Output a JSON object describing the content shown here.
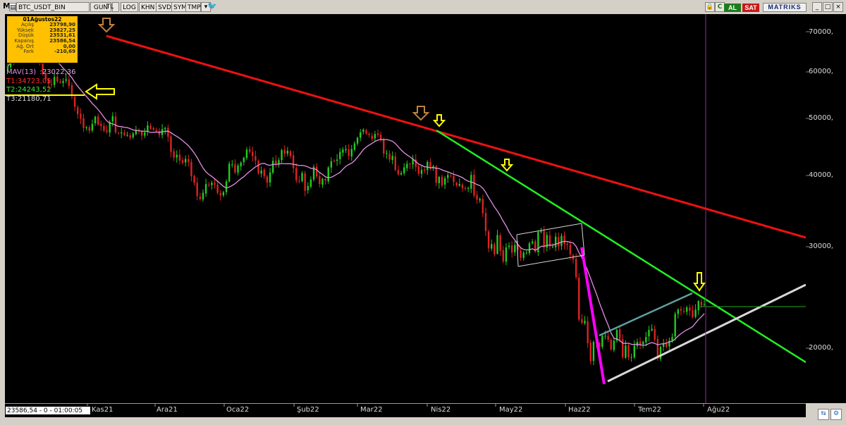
{
  "toolbar": {
    "m_label": "M",
    "symbol": "BTC_USDT_BIN",
    "period": "GUN",
    "currency": "TL",
    "buttons": [
      "LOG",
      "KHN",
      "SVD",
      "SYM",
      "TMP"
    ],
    "al_label": "AL",
    "sat_label": "SAT",
    "brand": "MATRIKS"
  },
  "info_box": {
    "date": "01Ağustos22",
    "rows": [
      {
        "label": "Açılış",
        "value": "23798,90"
      },
      {
        "label": "Yüksek",
        "value": "23827,25"
      },
      {
        "label": "Düşük",
        "value": "23531,61"
      },
      {
        "label": "Kapanış",
        "value": "23586,54"
      },
      {
        "label": "Ağ. Ort",
        "value": "0,00"
      },
      {
        "label": "Fark",
        "value": "-210,69"
      }
    ]
  },
  "indicators": {
    "mav_name": "MAV(13)",
    "mav_value": ":23022,36",
    "t1": "T1:34723,05",
    "t2": "T2:24243,52",
    "t3": "T3:21180,71"
  },
  "status_text": "23586,54 - 0 - 01:00:05",
  "x_axis": [
    "Kas21",
    "Ara21",
    "Oca22",
    "Şub22",
    "Mar22",
    "Nis22",
    "May22",
    "Haz22",
    "Tem22",
    "Ağu22"
  ],
  "y_axis": [
    "70000,",
    "60000,",
    "50000,",
    "40000,",
    "30000,",
    "20000,"
  ],
  "colors": {
    "up": "#22cc22",
    "down": "#dd2222",
    "mav": "#e090e0",
    "trend_red": "#ee1111",
    "trend_green": "#22ee22",
    "arrow_brown": "#c08040",
    "arrow_yellow": "#ffff00"
  },
  "chart_data": {
    "type": "candlestick",
    "symbol": "BTC_USDT_BIN",
    "log_scale": true,
    "ylim": [
      16000,
      75000
    ],
    "x_ticks": [
      "Kas21",
      "Ara21",
      "Oca22",
      "Şub22",
      "Mar22",
      "Nis22",
      "May22",
      "Haz22",
      "Tem22",
      "Ağu22"
    ],
    "y_ticks": [
      70000,
      60000,
      50000,
      40000,
      30000,
      20000
    ],
    "closes": [
      61000,
      63000,
      62500,
      65000,
      64500,
      66000,
      68500,
      67000,
      66500,
      64800,
      65500,
      62000,
      59500,
      58000,
      57000,
      56800,
      58500,
      57500,
      57300,
      57600,
      58000,
      56500,
      54200,
      52000,
      50500,
      49600,
      47800,
      48000,
      47300,
      48600,
      50000,
      48500,
      48200,
      47300,
      47100,
      49000,
      50100,
      47000,
      46800,
      47000,
      46500,
      46500,
      46000,
      46800,
      47500,
      47200,
      46400,
      47000,
      48300,
      47700,
      47500,
      47200,
      46500,
      47600,
      47800,
      46200,
      43500,
      42500,
      43000,
      42000,
      41600,
      42300,
      41800,
      39500,
      38500,
      36500,
      36100,
      37000,
      38300,
      38100,
      38500,
      38200,
      37000,
      36600,
      37100,
      38700,
      41500,
      41400,
      40100,
      41200,
      41700,
      42500,
      43900,
      43500,
      42800,
      42000,
      40000,
      40400,
      39500,
      38500,
      40100,
      42000,
      41500,
      42100,
      43800,
      43200,
      43700,
      42800,
      40800,
      38900,
      38800,
      40000,
      37300,
      38000,
      39000,
      41000,
      39500,
      38300,
      39100,
      38800,
      40900,
      41900,
      41900,
      42200,
      43500,
      43900,
      44000,
      42800,
      44000,
      45000,
      46000,
      47000,
      47500,
      46800,
      46500,
      45800,
      46700,
      46500,
      45600,
      43200,
      43300,
      42200,
      42800,
      40500,
      39800,
      40000,
      40900,
      41500,
      41400,
      42300,
      41000,
      39900,
      40500,
      40400,
      41800,
      40800,
      41100,
      38500,
      39400,
      38100,
      39200,
      39700,
      39500,
      38600,
      38100,
      38300,
      37700,
      37600,
      37700,
      39700,
      36600,
      36000,
      36100,
      34100,
      31800,
      29700,
      30200,
      29000,
      31300,
      29400,
      28200,
      29800,
      30000,
      29200,
      30100,
      29500,
      28600,
      29200,
      29200,
      30300,
      30500,
      29300,
      31700,
      31800,
      29800,
      31300,
      29900,
      29900,
      31100,
      29900,
      31200,
      30200,
      30100,
      29000,
      28400,
      26500,
      22400,
      22100,
      22300,
      20400,
      19000,
      20500,
      20400,
      20100,
      21000,
      21000,
      20700,
      19900,
      20600,
      21500,
      20700,
      19300,
      20200,
      19300,
      19300,
      20200,
      20500,
      20300,
      20500,
      20900,
      21500,
      21600,
      20700,
      19200,
      20100,
      20400,
      20100,
      20600,
      20900,
      22900,
      23300,
      23200,
      23100,
      23500,
      23200,
      22600,
      23300,
      24100,
      23700,
      23800
    ]
  }
}
